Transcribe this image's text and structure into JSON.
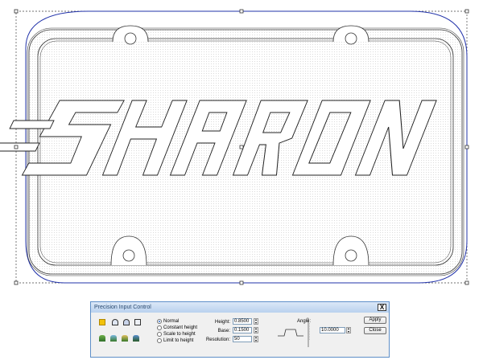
{
  "canvas": {
    "plate_outline_color": "#333333",
    "selection_outline_color": "#2233aa",
    "text_art": "SHARON"
  },
  "dialog": {
    "title": "Precision Input Control",
    "close_label": "X",
    "tool_icons": [
      "flat-color-icon",
      "shape-icon-1",
      "shape-icon-2",
      "shape-icon-3",
      "terrain-icon-1",
      "terrain-icon-2",
      "terrain-icon-3",
      "terrain-icon-4"
    ],
    "modes": [
      {
        "label": "Normal",
        "selected": true
      },
      {
        "label": "Constant height",
        "selected": false
      },
      {
        "label": "Scale to height",
        "selected": false
      },
      {
        "label": "Limit to height",
        "selected": false
      }
    ],
    "fields": {
      "height_label": "Height:",
      "height_value": "0.8500",
      "base_label": "Base:",
      "base_value": "0.1500",
      "resolution_label": "Resolution:",
      "resolution_value": "50",
      "angle_label": "Angle:",
      "angle_value": "10.0000"
    },
    "buttons": {
      "apply": "Apply",
      "close": "Close"
    }
  }
}
